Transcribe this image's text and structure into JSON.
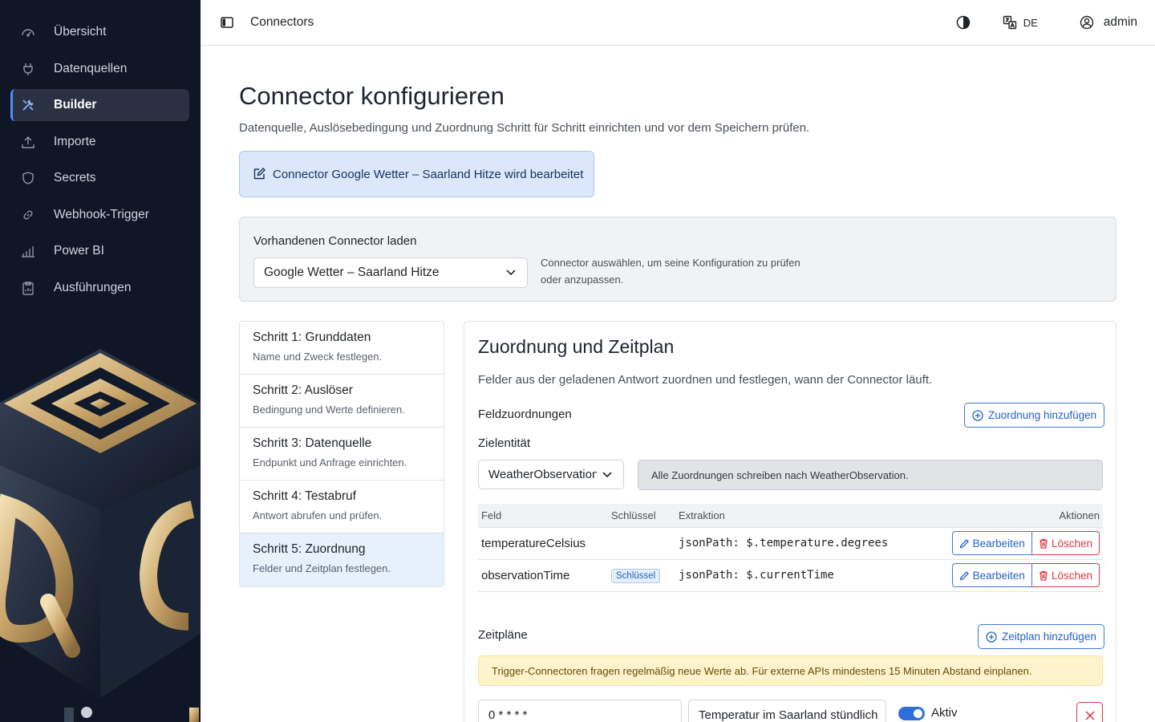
{
  "sidebar": {
    "items": [
      {
        "label": "Übersicht",
        "icon": "gauge-icon"
      },
      {
        "label": "Datenquellen",
        "icon": "plug-icon"
      },
      {
        "label": "Builder",
        "icon": "tools-icon",
        "active": true
      },
      {
        "label": "Importe",
        "icon": "upload-icon"
      },
      {
        "label": "Secrets",
        "icon": "shield-icon"
      },
      {
        "label": "Webhook-Trigger",
        "icon": "link-icon"
      },
      {
        "label": "Power BI",
        "icon": "bar-chart-icon"
      },
      {
        "label": "Ausführungen",
        "icon": "clipboard-icon"
      }
    ]
  },
  "header": {
    "title": "Connectors",
    "language": "DE",
    "user": "admin"
  },
  "page": {
    "title": "Connector konfigurieren",
    "subtitle": "Datenquelle, Auslösebedingung und Zuordnung Schritt für Schritt einrichten und vor dem Speichern prüfen.",
    "edit_banner": "Connector Google Wetter – Saarland Hitze wird bearbeitet"
  },
  "load": {
    "label": "Vorhandenen Connector laden",
    "selected": "Google Wetter – Saarland Hitze",
    "help": "Connector auswählen, um seine Konfiguration zu prüfen oder anzupassen."
  },
  "steps": [
    {
      "title": "Schritt 1: Grunddaten",
      "desc": "Name und Zweck festlegen."
    },
    {
      "title": "Schritt 2: Auslöser",
      "desc": "Bedingung und Werte definieren."
    },
    {
      "title": "Schritt 3: Datenquelle",
      "desc": "Endpunkt und Anfrage einrichten."
    },
    {
      "title": "Schritt 4: Testabruf",
      "desc": "Antwort abrufen und prüfen."
    },
    {
      "title": "Schritt 5: Zuordnung",
      "desc": "Felder und Zeitplan festlegen.",
      "active": true
    }
  ],
  "mapping": {
    "title": "Zuordnung und Zeitplan",
    "subtitle": "Felder aus der geladenen Antwort zuordnen und festlegen, wann der Connector läuft.",
    "field_mappings_label": "Feldzuordnungen",
    "add_mapping_label": "Zuordnung hinzufügen",
    "target_entity_label": "Zielentität",
    "target_entity_value": "WeatherObservation",
    "entity_info": "Alle Zuordnungen schreiben nach WeatherObservation.",
    "table": {
      "headers": [
        "Feld",
        "Schlüssel",
        "Extraktion",
        "Aktionen"
      ],
      "rows": [
        {
          "field": "temperatureCelsius",
          "key": "",
          "extraction": "jsonPath: $.temperature.degrees"
        },
        {
          "field": "observationTime",
          "key": "Schlüssel",
          "extraction": "jsonPath: $.currentTime"
        }
      ],
      "edit_label": "Bearbeiten",
      "delete_label": "Löschen"
    },
    "schedules_label": "Zeitpläne",
    "add_schedule_label": "Zeitplan hinzufügen",
    "warning": "Trigger-Connectoren fragen regelmäßig neue Werte ab. Für externe APIs mindestens 15 Minuten Abstand einplanen.",
    "schedule": {
      "cron": "0 * * * *",
      "name": "Temperatur im Saarland stündlich",
      "active_label": "Aktiv",
      "active": true
    }
  },
  "colors": {
    "sidebar_bg": "#0f1626",
    "accent": "#2461c4",
    "danger": "#dc3545",
    "warning_bg": "#fff3cd"
  }
}
